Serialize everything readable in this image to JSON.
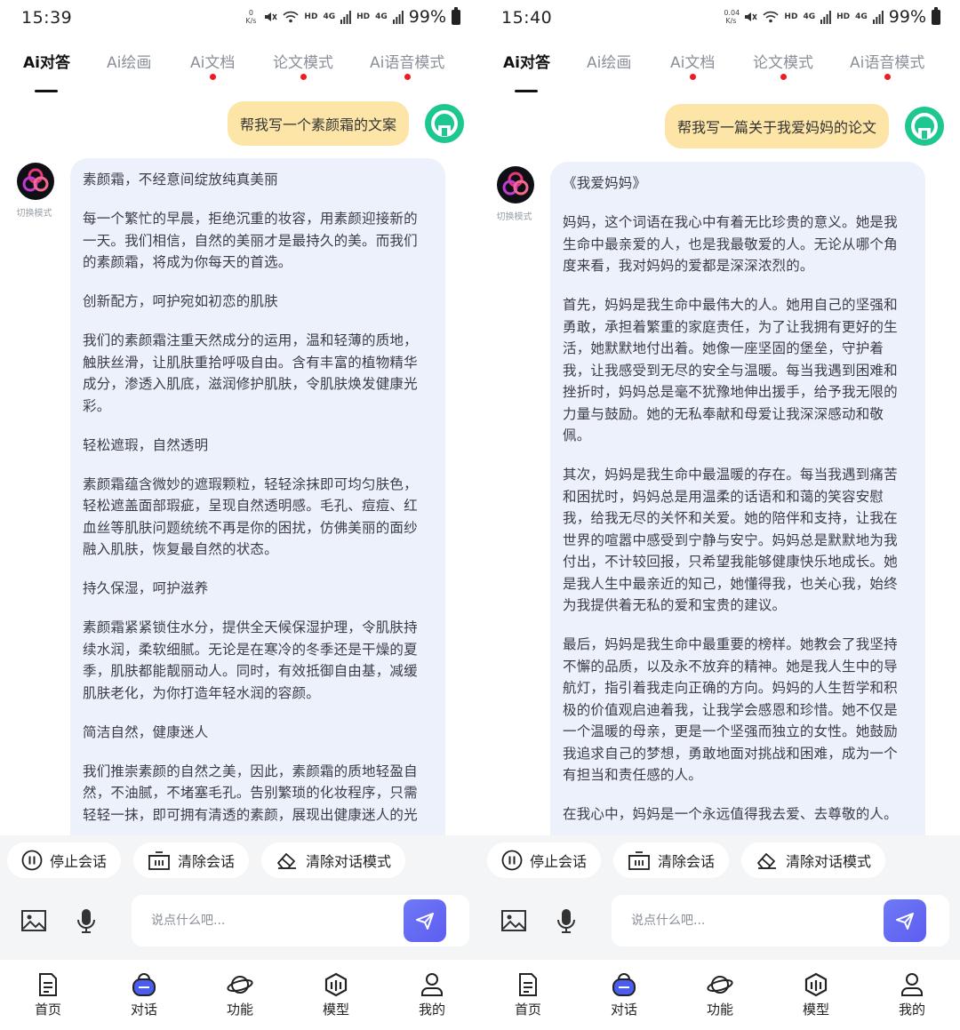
{
  "colors": {
    "active_tab": "#111111",
    "inactive_tab": "#8a8f99",
    "notification_dot": "#ee1c25",
    "user_bubble": "#fde5a8",
    "bot_bubble": "#edf1fc",
    "send_button": "#5d5cf0",
    "user_avatar": "#1dc790"
  },
  "left": {
    "status": {
      "time": "15:39",
      "net_speed_value": "0",
      "net_speed_unit": "K/s",
      "hd1": "HD",
      "sig1": "4G",
      "hd2": "HD",
      "sig2": "4G",
      "battery": "99%"
    },
    "tabs": [
      {
        "label": "Ai对答",
        "active": true,
        "dot": false
      },
      {
        "label": "Ai绘画",
        "active": false,
        "dot": false
      },
      {
        "label": "Ai文档",
        "active": false,
        "dot": true
      },
      {
        "label": "论文模式",
        "active": false,
        "dot": true
      },
      {
        "label": "Ai语音模式",
        "active": false,
        "dot": true
      }
    ],
    "user_message": "帮我写一个素颜霜的文案",
    "bot_label": "切换模式",
    "bot_paragraphs": [
      "素颜霜，不经意间绽放纯真美丽",
      "每一个繁忙的早晨，拒绝沉重的妆容，用素颜迎接新的一天。我们相信，自然的美丽才是最持久的美。而我们的素颜霜，将成为你每天的首选。",
      "创新配方，呵护宛如初恋的肌肤",
      "我们的素颜霜注重天然成分的运用，温和轻薄的质地，触肤丝滑，让肌肤重拾呼吸自由。含有丰富的植物精华成分，渗透入肌底，滋润修护肌肤，令肌肤焕发健康光彩。",
      "轻松遮瑕，自然透明",
      "素颜霜蕴含微妙的遮瑕颗粒，轻轻涂抹即可均匀肤色，轻松遮盖面部瑕疵，呈现自然透明感。毛孔、痘痘、红血丝等肌肤问题统统不再是你的困扰，仿佛美丽的面纱融入肌肤，恢复最自然的状态。",
      "持久保湿，呵护滋养",
      "素颜霜紧紧锁住水分，提供全天候保湿护理，令肌肤持续水润，柔软细腻。无论是在寒冷的冬季还是干燥的夏季，肌肤都能靓丽动人。同时，有效抵御自由基，减缓肌肤老化，为你打造年轻水润的容颜。",
      "简洁自然，健康迷人",
      "我们推崇素颜的自然之美，因此，素颜霜的质地轻盈自然，不油腻，不堵塞毛孔。告别繁琐的化妆程序，只需轻轻一抹，即可拥有清透的素颜，展现出健康迷人的光"
    ],
    "actions": [
      "停止会话",
      "清除会话",
      "清除对话模式"
    ],
    "input_placeholder": "说点什么吧...",
    "nav": [
      "首页",
      "对话",
      "功能",
      "模型",
      "我的"
    ]
  },
  "right": {
    "status": {
      "time": "15:40",
      "net_speed_value": "0.04",
      "net_speed_unit": "K/s",
      "hd1": "HD",
      "sig1": "4G",
      "hd2": "HD",
      "sig2": "4G",
      "battery": "99%"
    },
    "tabs": [
      {
        "label": "Ai对答",
        "active": true,
        "dot": false
      },
      {
        "label": "Ai绘画",
        "active": false,
        "dot": false
      },
      {
        "label": "Ai文档",
        "active": false,
        "dot": true
      },
      {
        "label": "论文模式",
        "active": false,
        "dot": true
      },
      {
        "label": "Ai语音模式",
        "active": false,
        "dot": true
      }
    ],
    "user_message": "帮我写一篇关于我爱妈妈的论文",
    "bot_label": "切换模式",
    "bot_paragraphs": [
      "《我爱妈妈》",
      "妈妈，这个词语在我心中有着无比珍贵的意义。她是我生命中最亲爱的人，也是我最敬爱的人。无论从哪个角度来看，我对妈妈的爱都是深深浓烈的。",
      "首先，妈妈是我生命中最伟大的人。她用自己的坚强和勇敢，承担着繁重的家庭责任，为了让我拥有更好的生活，她默默地付出着。她像一座坚固的堡垒，守护着我，让我感受到无尽的安全与温暖。每当我遇到困难和挫折时，妈妈总是毫不犹豫地伸出援手，给予我无限的力量与鼓励。她的无私奉献和母爱让我深深感动和敬佩。",
      "其次，妈妈是我生命中最温暖的存在。每当我遇到痛苦和困扰时，妈妈总是用温柔的话语和和蔼的笑容安慰我，给我无尽的关怀和关爱。她的陪伴和支持，让我在世界的喧嚣中感受到宁静与安宁。妈妈总是默默地为我付出，不计较回报，只希望我能够健康快乐地成长。她是我人生中最亲近的知己，她懂得我，也关心我，始终为我提供着无私的爱和宝贵的建议。",
      "最后，妈妈是我生命中最重要的榜样。她教会了我坚持不懈的品质，以及永不放弃的精神。她是我人生中的导航灯，指引着我走向正确的方向。妈妈的人生哲学和积极的价值观启迪着我，让我学会感恩和珍惜。她不仅是一个温暖的母亲，更是一个坚强而独立的女性。她鼓励我追求自己的梦想，勇敢地面对挑战和困难，成为一个有担当和责任感的人。",
      "在我心中，妈妈是一个永远值得我去爱、去尊敬的人。"
    ],
    "actions": [
      "停止会话",
      "清除会话",
      "清除对话模式"
    ],
    "input_placeholder": "说点什么吧...",
    "nav": [
      "首页",
      "对话",
      "功能",
      "模型",
      "我的"
    ]
  }
}
